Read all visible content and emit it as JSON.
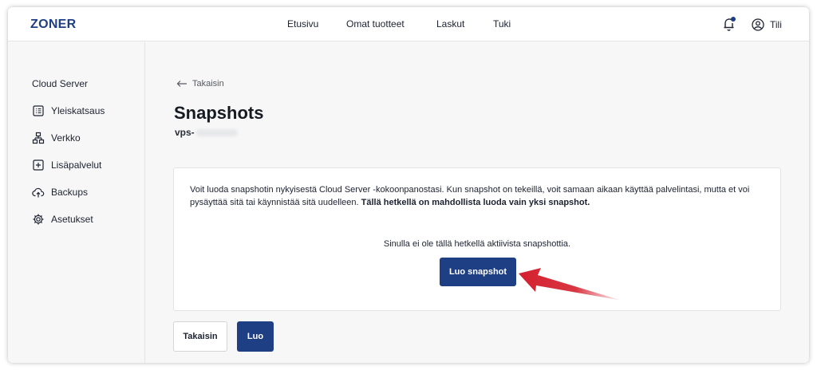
{
  "header": {
    "logo": "ZONER",
    "nav": [
      {
        "label": "Etusivu"
      },
      {
        "label": "Omat tuotteet"
      },
      {
        "label": "Laskut"
      },
      {
        "label": "Tuki"
      }
    ],
    "account_label": "Tili"
  },
  "sidebar": {
    "title": "Cloud Server",
    "items": [
      {
        "label": "Yleiskatsaus",
        "icon": "list-icon"
      },
      {
        "label": "Verkko",
        "icon": "network-icon"
      },
      {
        "label": "Lisäpalvelut",
        "icon": "plus-box-icon"
      },
      {
        "label": "Backups",
        "icon": "cloud-upload-icon"
      },
      {
        "label": "Asetukset",
        "icon": "gear-icon"
      }
    ]
  },
  "main": {
    "back_label": "Takaisin",
    "title": "Snapshots",
    "server_prefix": "vps-",
    "info_text": "Voit luoda snapshotin nykyisestä Cloud Server -kokoonpanostasi. Kun snapshot on tekeillä, voit samaan aikaan käyttää palvelintasi, mutta et voi pysäyttää sitä tai käynnistää sitä uudelleen.",
    "info_bold": "Tällä hetkellä on mahdollista luoda vain yksi snapshot.",
    "empty_text": "Sinulla ei ole tällä hetkellä aktiivista snapshottia.",
    "create_snapshot_label": "Luo snapshot",
    "back_button_label": "Takaisin",
    "create_button_label": "Luo"
  },
  "colors": {
    "brand": "#1f3f84",
    "annotation_arrow": "#d4202e"
  }
}
